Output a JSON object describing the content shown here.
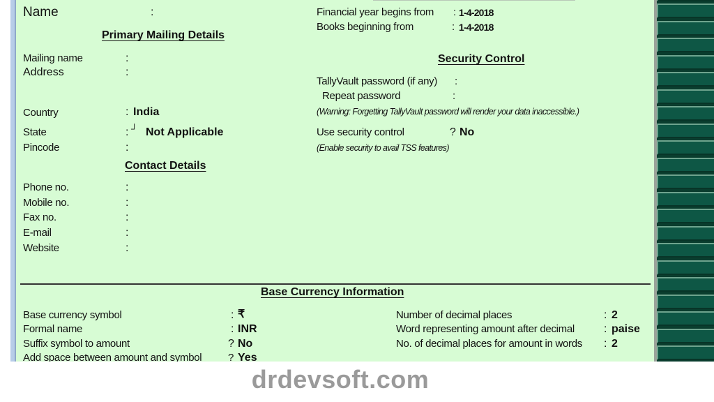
{
  "company_form": {
    "name": {
      "label": "Name",
      "sep": ":",
      "value": ""
    },
    "primary_mailing": {
      "heading": "Primary Mailing Details",
      "mailing_name": {
        "label": "Mailing name",
        "sep": ":",
        "value": ""
      },
      "address": {
        "label": "Address",
        "sep": ":",
        "value": ""
      },
      "country": {
        "label": "Country",
        "sep": ":",
        "value": "India"
      },
      "state": {
        "label": "State",
        "sep": ":",
        "marker": "┘",
        "value": "Not Applicable"
      },
      "pincode": {
        "label": "Pincode",
        "sep": ":",
        "value": ""
      }
    },
    "contact": {
      "heading": "Contact Details",
      "fields": [
        {
          "label": "Phone no.",
          "sep": ":",
          "value": ""
        },
        {
          "label": "Mobile no.",
          "sep": ":",
          "value": ""
        },
        {
          "label": "Fax no.",
          "sep": ":",
          "value": ""
        },
        {
          "label": "E-mail",
          "sep": ":",
          "value": ""
        },
        {
          "label": "Website",
          "sep": ":",
          "value": ""
        }
      ]
    },
    "books": {
      "financial_year": {
        "label": "Financial year begins from",
        "sep": ":",
        "value": "1-4-2018"
      },
      "books_beginning": {
        "label": "Books beginning from",
        "sep": ":",
        "value": "1-4-2018"
      }
    },
    "security": {
      "heading": "Security Control",
      "tallyvault": {
        "label": "TallyVault password (if any)",
        "sep": ":",
        "value": ""
      },
      "repeat": {
        "label": "Repeat password",
        "sep": ":",
        "value": ""
      },
      "warning": "(Warning: Forgetting TallyVault password will render your data inaccessible.)",
      "use_security": {
        "label": "Use security control",
        "sep": "?",
        "value": "No"
      },
      "hint": "(Enable security to avail TSS features)"
    },
    "base_currency": {
      "heading": "Base Currency Information",
      "symbol": {
        "label": "Base currency symbol",
        "sep": ":",
        "value": "₹"
      },
      "formal_name": {
        "label": "Formal name",
        "sep": ":",
        "value": "INR"
      },
      "suffix": {
        "label": "Suffix symbol to amount",
        "sep": "?",
        "value": "No"
      },
      "add_space": {
        "label": "Add space between amount and symbol",
        "sep": "?",
        "value": "Yes"
      },
      "decimal_places": {
        "label": "Number of decimal places",
        "sep": ":",
        "value": "2"
      },
      "word_after_decimal": {
        "label": "Word representing amount after decimal",
        "sep": ":",
        "value": "paise"
      },
      "decimal_words": {
        "label": "No. of decimal places for amount in words",
        "sep": ":",
        "value": "2"
      }
    }
  },
  "side_buttons_count": 22,
  "watermark": "drdevsoft.com",
  "colors": {
    "panel_bg": "#d7fcd4",
    "button_bg": "#0e5745",
    "watermark": "#9a9a9a"
  }
}
